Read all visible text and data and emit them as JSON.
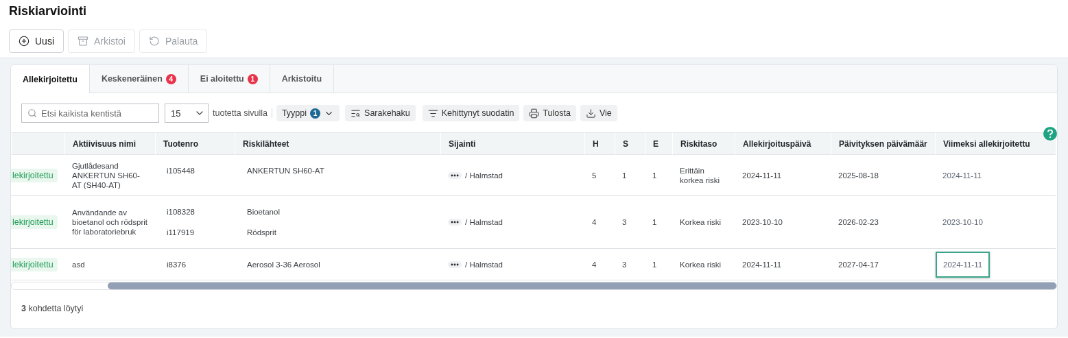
{
  "page": {
    "title": "Riskiarviointi"
  },
  "actions": [
    {
      "label": "Uusi",
      "disabled": false
    },
    {
      "label": "Arkistoi",
      "disabled": true
    },
    {
      "label": "Palauta",
      "disabled": true
    }
  ],
  "tabs": [
    {
      "label": "Allekirjoitettu",
      "selected": true
    },
    {
      "label": "Keskeneräinen",
      "selected": false,
      "count": "4"
    },
    {
      "label": "Ei aloitettu",
      "selected": false,
      "count": "1"
    },
    {
      "label": "Arkistoitu",
      "selected": false
    }
  ],
  "toolbar": {
    "search": {
      "placeholder": "Etsi kaikista kentistä"
    },
    "page_size": {
      "value": "15",
      "suffix": "tuotetta sivulla"
    },
    "buttons": [
      {
        "label": "Tyyppi",
        "count": "1"
      },
      {
        "label": "Sarakehaku"
      },
      {
        "label": "Kehittynyt suodatin"
      },
      {
        "label": "Tulosta"
      },
      {
        "label": "Vie"
      }
    ]
  },
  "table": {
    "columns": [
      "",
      "Aktiivisuus nimi",
      "Tuotenro",
      "Riskilähteet",
      "Sijainti",
      "H",
      "S",
      "E",
      "Riskitaso",
      "Allekirjoituspäivä",
      "Päivityksen päivämäär",
      "Viimeksi allekirjoitettu"
    ],
    "rows": [
      {
        "status": "lekirjoitettu",
        "name": "Gjutlådesand ANKERTUN SH60-AT (SH40-AT)",
        "products": [
          "i105448"
        ],
        "sources": [
          "ANKERTUN SH60-AT"
        ],
        "location": "/ Halmstad",
        "h": "5",
        "s": "1",
        "e": "1",
        "risk": "Erittäin korkea riski",
        "signed": "2024-11-11",
        "updated": "2025-08-18",
        "last_signed": "2024-11-11",
        "focused": false
      },
      {
        "status": "lekirjoitettu",
        "name": "Användande av bioetanol och rödsprit för laboratoriebruk",
        "products": [
          "i108328",
          "i117919"
        ],
        "sources": [
          "Bioetanol",
          "Rödsprit"
        ],
        "location": "/ Halmstad",
        "h": "4",
        "s": "3",
        "e": "1",
        "risk": "Korkea riski",
        "signed": "2023-10-10",
        "updated": "2026-02-23",
        "last_signed": "2023-10-10",
        "focused": false
      },
      {
        "status": "lekirjoitettu",
        "name": "asd",
        "products": [
          "i8376"
        ],
        "sources": [
          "Aerosol 3-36 Aerosol"
        ],
        "location": "/ Halmstad",
        "h": "4",
        "s": "3",
        "e": "1",
        "risk": "Korkea riski",
        "signed": "2024-11-11",
        "updated": "2027-04-17",
        "last_signed": "2024-11-11",
        "focused": true
      }
    ]
  },
  "footer": {
    "count": "3",
    "text": "kohdetta löytyi"
  }
}
